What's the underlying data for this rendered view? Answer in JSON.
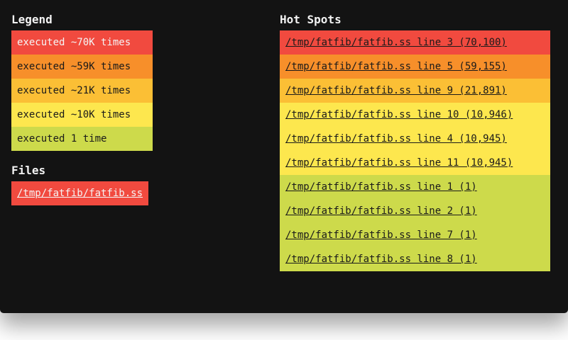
{
  "legend": {
    "title": "Legend",
    "items": [
      {
        "label": "executed ~70K times",
        "color": "#f14a3f",
        "text_color": "#f5f5f5"
      },
      {
        "label": "executed ~59K times",
        "color": "#f78f2a",
        "text_color": "#1a1a1a"
      },
      {
        "label": "executed ~21K times",
        "color": "#fbbf35",
        "text_color": "#1a1a1a"
      },
      {
        "label": "executed ~10K times",
        "color": "#fde74e",
        "text_color": "#1a1a1a"
      },
      {
        "label": "executed 1 time",
        "color": "#cdda4b",
        "text_color": "#1a1a1a"
      }
    ]
  },
  "files": {
    "title": "Files",
    "items": [
      {
        "label": "/tmp/fatfib/fatfib.ss",
        "color": "#f14a3f",
        "text_color": "#f5f5f5"
      }
    ]
  },
  "hotspots": {
    "title": "Hot Spots",
    "items": [
      {
        "label": "/tmp/fatfib/fatfib.ss line 3 (70,100)",
        "color": "#f14a3f"
      },
      {
        "label": "/tmp/fatfib/fatfib.ss line 5 (59,155)",
        "color": "#f78f2a"
      },
      {
        "label": "/tmp/fatfib/fatfib.ss line 9 (21,891)",
        "color": "#fbbf35"
      },
      {
        "label": "/tmp/fatfib/fatfib.ss line 10 (10,946)",
        "color": "#fde74e"
      },
      {
        "label": "/tmp/fatfib/fatfib.ss line 4 (10,945)",
        "color": "#fde74e"
      },
      {
        "label": "/tmp/fatfib/fatfib.ss line 11 (10,945)",
        "color": "#fde74e"
      },
      {
        "label": "/tmp/fatfib/fatfib.ss line 1 (1)",
        "color": "#cdda4b"
      },
      {
        "label": "/tmp/fatfib/fatfib.ss line 2 (1)",
        "color": "#cdda4b"
      },
      {
        "label": "/tmp/fatfib/fatfib.ss line 7 (1)",
        "color": "#cdda4b"
      },
      {
        "label": "/tmp/fatfib/fatfib.ss line 8 (1)",
        "color": "#cdda4b"
      }
    ]
  }
}
